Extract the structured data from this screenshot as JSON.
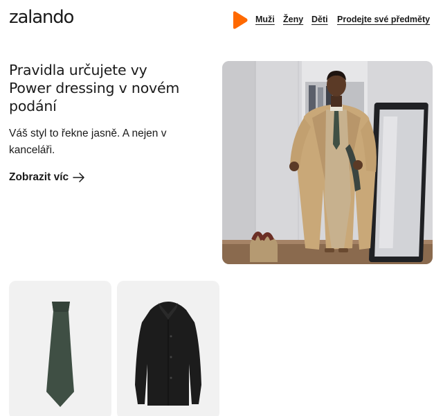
{
  "header": {
    "logo_text": "zalando",
    "brand_color": "#ff6900",
    "nav": [
      {
        "label": "Muži"
      },
      {
        "label": "Ženy"
      },
      {
        "label": "Děti"
      },
      {
        "label": "Prodejte své předměty"
      }
    ]
  },
  "hero": {
    "title_line1": "Pravidla určujete vy",
    "title_line2": "Power dressing v novém",
    "title_line3": "podání",
    "subtitle": "Váš styl to řekne jasně. A nejen v kanceláři.",
    "link_label": "Zobrazit víc",
    "link_icon": "arrow-right-icon",
    "image": "man-in-beige-trench-coat-photo"
  },
  "products": [
    {
      "image": "green-tie-photo",
      "color": "#3f4f44"
    },
    {
      "image": "black-coat-photo",
      "color": "#1c1c1c"
    }
  ]
}
